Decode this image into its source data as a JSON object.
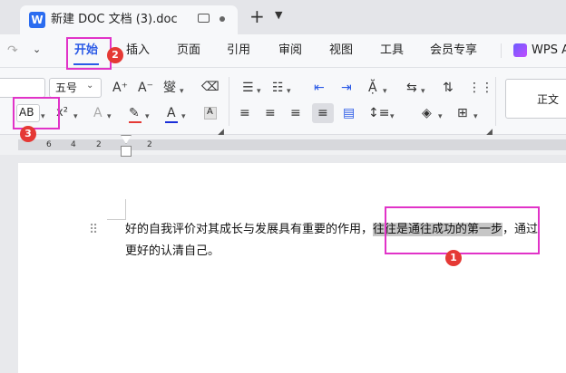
{
  "tab": {
    "app_icon_letter": "W",
    "title": "新建 DOC 文档 (3).doc"
  },
  "menu": {
    "items": [
      "开始",
      "插入",
      "页面",
      "引用",
      "审阅",
      "视图",
      "工具",
      "会员专享"
    ],
    "wps_ai": "WPS A"
  },
  "ribbon": {
    "font_size": "五号",
    "style_normal": "正文",
    "text_effect": "AB",
    "superscript": "x²",
    "font_grow": "A⁺",
    "font_shrink": "A⁻",
    "phonetic": "燮"
  },
  "ruler": {
    "numbers": [
      "6",
      "4",
      "2",
      "2"
    ]
  },
  "document": {
    "line1_before": "好的自我评价对其成长与发展具有重要的作用，",
    "line1_selected": "往往是通往成功的第一步",
    "line1_after": "，通过",
    "line2": "更好的认清自己。"
  },
  "annotations": {
    "badge1": "1",
    "badge2": "2",
    "badge3": "3"
  },
  "colors": {
    "accent": "#2b5ae6",
    "annotation_box": "#e133c8",
    "badge": "#e53935",
    "selection": "#c6c6c6"
  }
}
